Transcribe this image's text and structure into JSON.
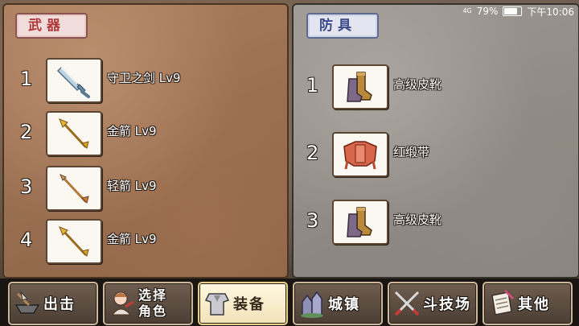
{
  "status_bar": {
    "network": "4G",
    "battery": "79%",
    "time": "下午10:06"
  },
  "weapons": {
    "title": "武器",
    "items": [
      {
        "index": "1",
        "name": "守卫之剑 Lv9",
        "icon": "sword-icon"
      },
      {
        "index": "2",
        "name": "金箭 Lv9",
        "icon": "gold-arrow-icon"
      },
      {
        "index": "3",
        "name": "轻箭 Lv9",
        "icon": "light-arrow-icon"
      },
      {
        "index": "4",
        "name": "金箭 Lv9",
        "icon": "gold-arrow-icon"
      }
    ]
  },
  "armor": {
    "title": "防具",
    "items": [
      {
        "index": "1",
        "name": "高级皮靴",
        "icon": "leather-boots-icon"
      },
      {
        "index": "2",
        "name": "红缎带",
        "icon": "red-sash-icon"
      },
      {
        "index": "3",
        "name": "高级皮靴",
        "icon": "leather-boots-icon"
      }
    ]
  },
  "nav": {
    "sortie": "出击",
    "select_char_line1": "选择",
    "select_char_line2": "角色",
    "equip": "装备",
    "town": "城镇",
    "arena": "斗技场",
    "other": "其他"
  }
}
